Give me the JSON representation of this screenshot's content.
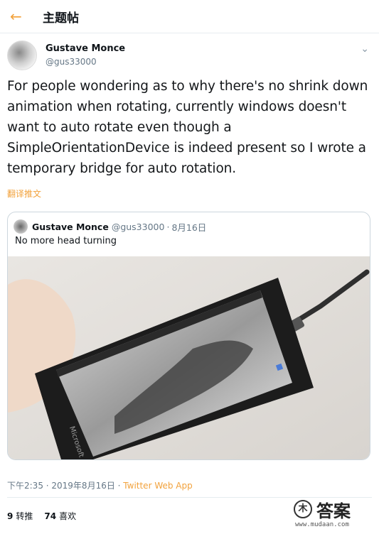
{
  "header": {
    "back_icon": "arrow-left-icon",
    "title": "主题帖"
  },
  "tweet": {
    "author_name": "Gustave Monce",
    "author_handle": "@gus33000",
    "text": "For people wondering as to why there's no shrink down animation when rotating, currently windows doesn't want to auto rotate even though a SimpleOrientationDevice is indeed present so I wrote a temporary bridge for auto rotation.",
    "translate_label": "翻译推文",
    "timestamp": "下午2:35 · 2019年8月16日 · ",
    "source": "Twitter Web App",
    "retweets_count": "9",
    "retweets_label": "转推",
    "likes_count": "74",
    "likes_label": "喜欢"
  },
  "quoted": {
    "author_name": "Gustave Monce",
    "author_handle": "@gus33000",
    "dot": "·",
    "date": "8月16日",
    "text": "No more head turning",
    "phone_brand": "Microsoft"
  },
  "watermark": {
    "logo_text": "答案",
    "url": "www.mudaan.com"
  },
  "colors": {
    "accent": "#f2a23c",
    "secondary_text": "#657786",
    "border": "#ccd6dd"
  }
}
